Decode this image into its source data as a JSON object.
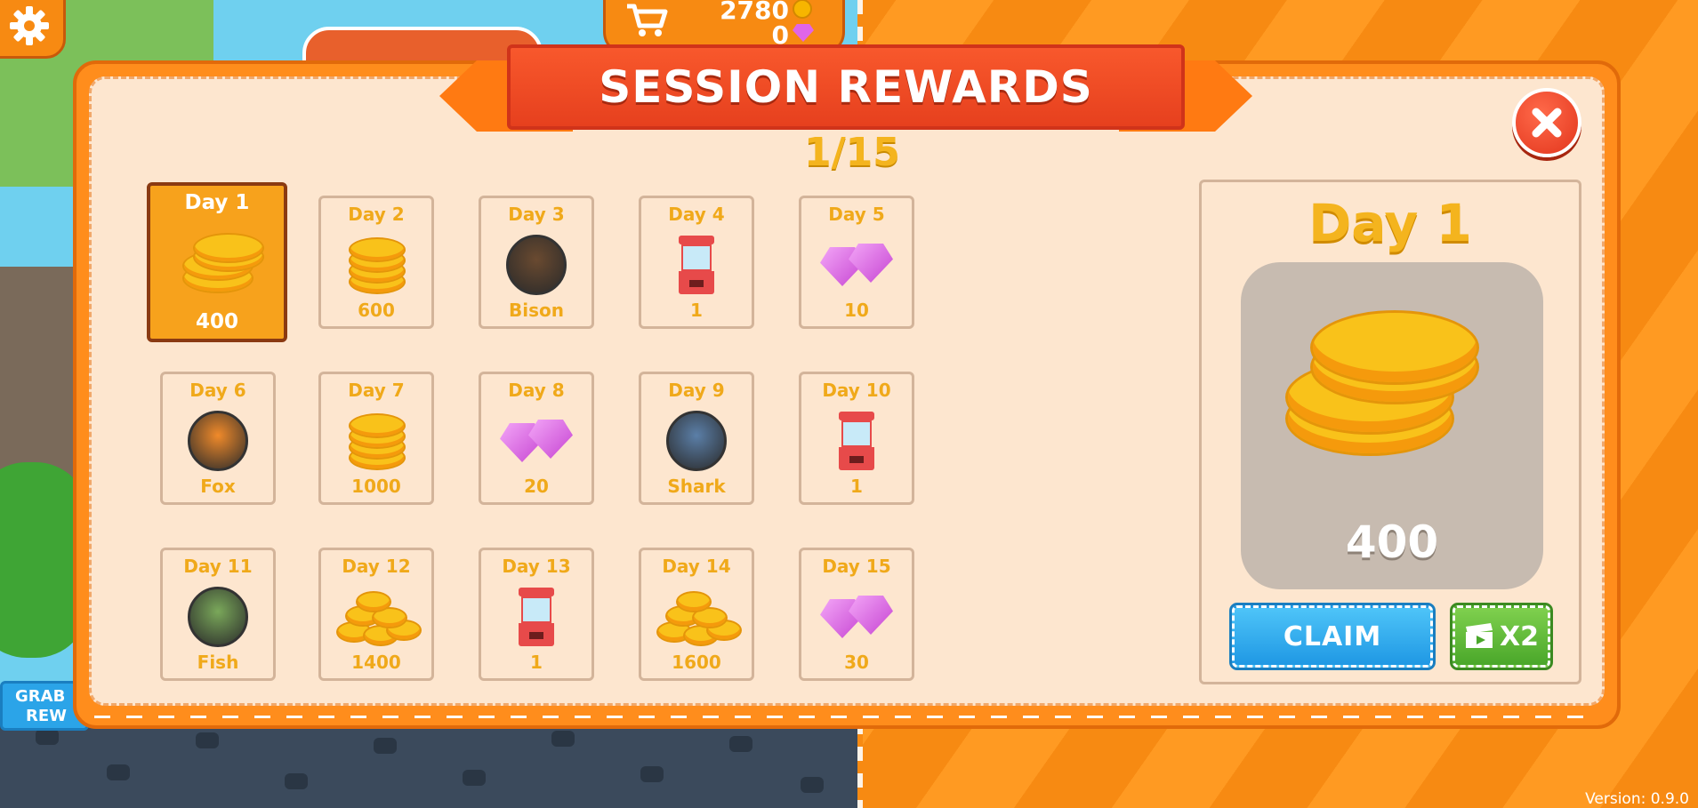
{
  "hud": {
    "coins": "2780",
    "gems": "0",
    "grab_label_line1": "GRAB",
    "grab_label_line2": "REW"
  },
  "modal": {
    "title": "SESSION REWARDS",
    "progress": "1/15"
  },
  "rewards": [
    {
      "day": "Day 1",
      "value": "400",
      "icon": "coin-stack-icon"
    },
    {
      "day": "Day 2",
      "value": "600",
      "icon": "coin-stack-icon"
    },
    {
      "day": "Day 3",
      "value": "Bison",
      "icon": "bison-portrait-icon"
    },
    {
      "day": "Day 4",
      "value": "1",
      "icon": "claw-machine-icon"
    },
    {
      "day": "Day 5",
      "value": "10",
      "icon": "gem-icon"
    },
    {
      "day": "Day 6",
      "value": "Fox",
      "icon": "fox-portrait-icon"
    },
    {
      "day": "Day 7",
      "value": "1000",
      "icon": "coin-stack-icon"
    },
    {
      "day": "Day 8",
      "value": "20",
      "icon": "gem-icon"
    },
    {
      "day": "Day 9",
      "value": "Shark",
      "icon": "shark-portrait-icon"
    },
    {
      "day": "Day 10",
      "value": "1",
      "icon": "claw-machine-icon"
    },
    {
      "day": "Day 11",
      "value": "Fish",
      "icon": "fish-portrait-icon"
    },
    {
      "day": "Day 12",
      "value": "1400",
      "icon": "coin-pile-icon"
    },
    {
      "day": "Day 13",
      "value": "1",
      "icon": "claw-machine-icon"
    },
    {
      "day": "Day 14",
      "value": "1600",
      "icon": "coin-pile-icon"
    },
    {
      "day": "Day 15",
      "value": "30",
      "icon": "gem-icon"
    }
  ],
  "selected": {
    "day": "Day 1",
    "amount": "400",
    "claim_label": "CLAIM",
    "x2_label": "X2"
  },
  "footer": {
    "version": "Version: 0.9.0"
  },
  "colors": {
    "accent_orange": "#f78a12",
    "title_ribbon": "#e6401e",
    "gold_text": "#f0a91a",
    "claim_blue": "#1f98e4",
    "x2_green": "#4aa72a"
  }
}
